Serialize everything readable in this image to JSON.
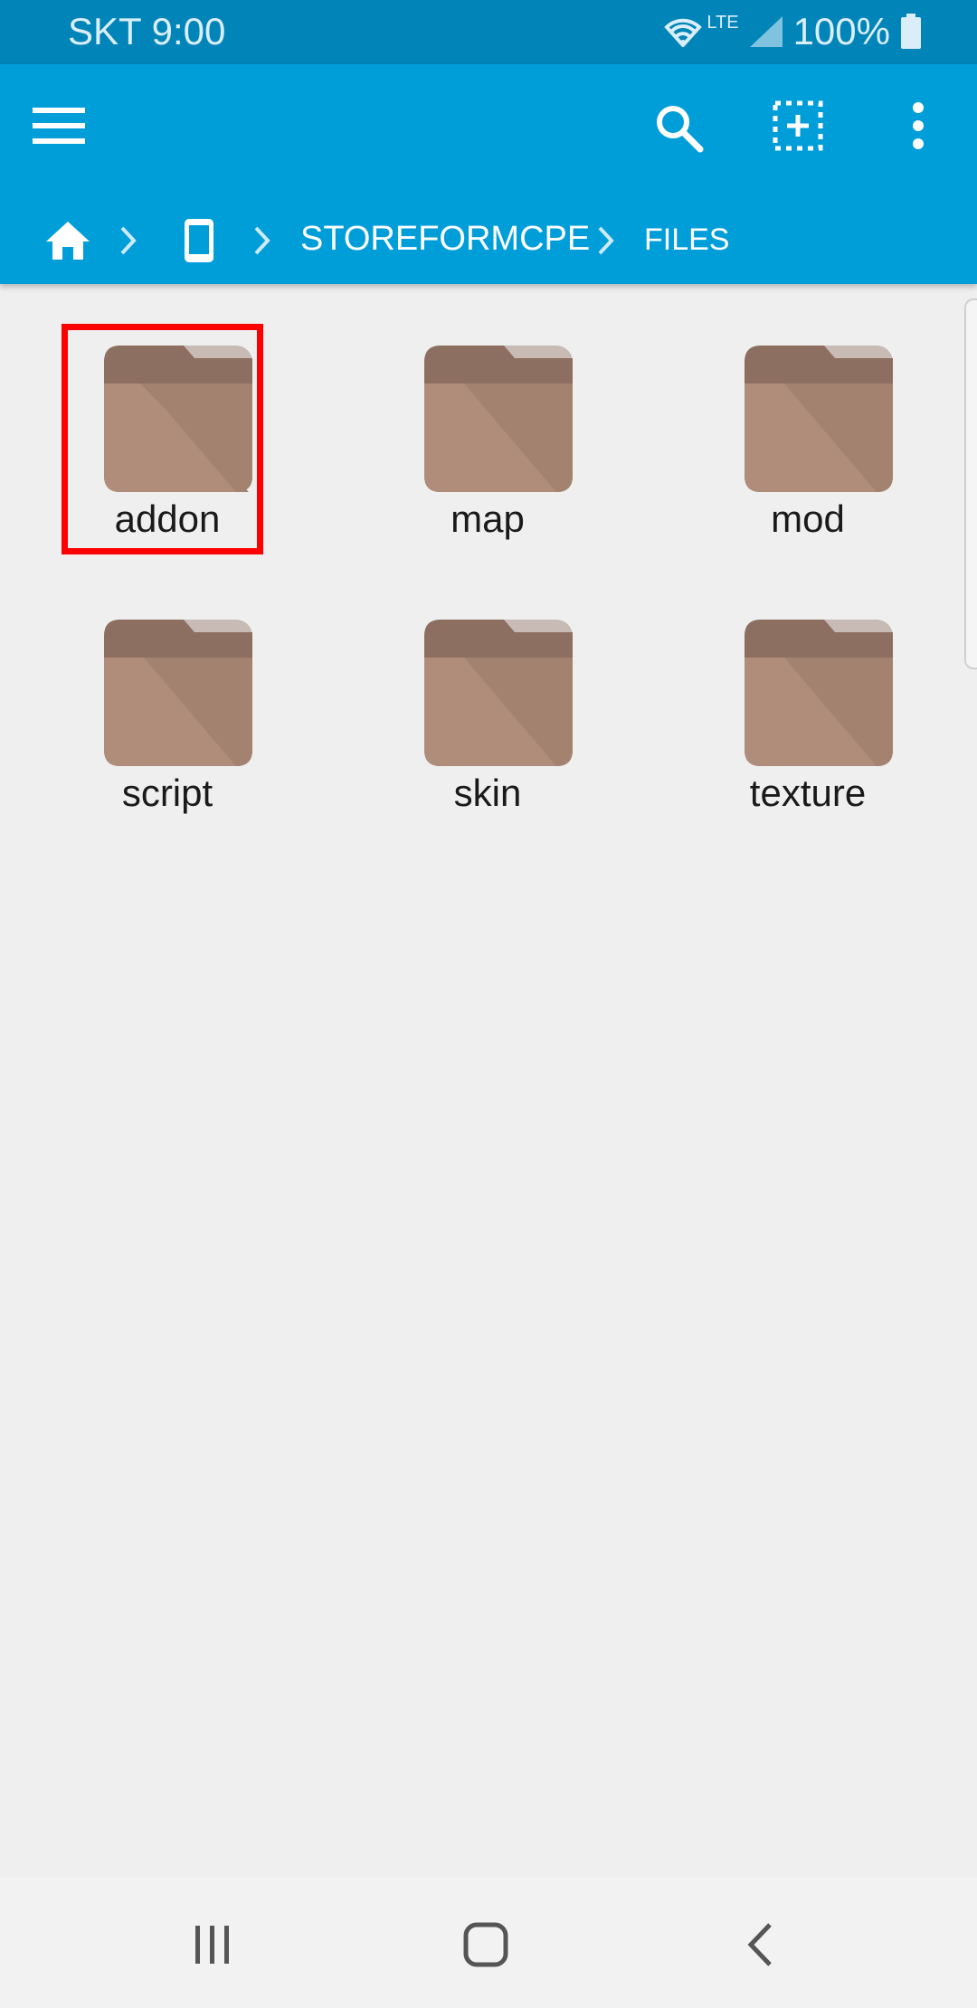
{
  "status_bar": {
    "carrier_time": "SKT 9:00",
    "network": "LTE",
    "battery": "100%"
  },
  "app_bar": {
    "menu_icon": "hamburger-menu-icon",
    "search_icon": "search-icon",
    "select_icon": "select-add-icon",
    "more_icon": "more-vert-icon"
  },
  "breadcrumb": {
    "items": [
      "home",
      "device",
      "StoreForMCPE",
      "files"
    ],
    "path_label": "STOREFORMCPE",
    "files_label": "FILES"
  },
  "folders": [
    {
      "name": "addon",
      "selected": true
    },
    {
      "name": "map",
      "selected": false
    },
    {
      "name": "mod",
      "selected": false
    },
    {
      "name": "script",
      "selected": false
    },
    {
      "name": "skin",
      "selected": false
    },
    {
      "name": "texture",
      "selected": false
    }
  ],
  "colors": {
    "status_bar": "#0184b8",
    "app_bar": "#009ed9",
    "folder": "#a98878",
    "highlight": "#ff0000",
    "background": "#efefef"
  },
  "nav_bar": {
    "recents_icon": "recent-apps-icon",
    "home_icon": "home-button-icon",
    "back_icon": "back-icon"
  }
}
